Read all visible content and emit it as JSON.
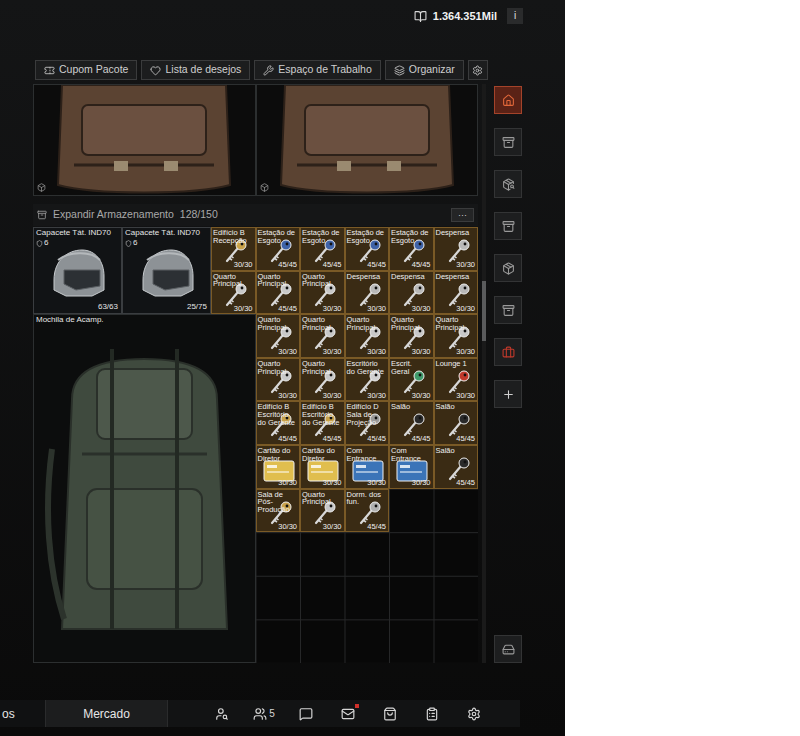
{
  "currency": {
    "amount": "1.364.351Mil",
    "info": "i"
  },
  "toolbar": [
    "Cupom Pacote",
    "Lista de desejos",
    "Espaço de Trabalho",
    "Organizar"
  ],
  "top_items": [
    {
      "kind": "backpack"
    },
    {
      "kind": "backpack"
    }
  ],
  "storage": {
    "title": "Expandir Armazenamento",
    "capacity": "128/150",
    "menu": "···"
  },
  "items": [
    {
      "kind": "helmet",
      "label": "Capacete Tát. IND70",
      "armor": "6",
      "count": "63/63"
    },
    {
      "kind": "helmet",
      "label": "Capacete Tát. IND70",
      "armor": "6",
      "count": "25/75"
    },
    {
      "kind": "key",
      "label": "Edifício B Recepção",
      "count": "30/30",
      "color": "#c9a24a"
    },
    {
      "kind": "key",
      "label": "Estação de Esgoto",
      "count": "45/45",
      "color": "#3f63a8"
    },
    {
      "kind": "key",
      "label": "Estação de Esgoto",
      "count": "45/45",
      "color": "#3f63a8"
    },
    {
      "kind": "key",
      "label": "Estação de Esgoto",
      "count": "45/45",
      "color": "#3f63a8"
    },
    {
      "kind": "key",
      "label": "Estação de Esgoto",
      "count": "45/45",
      "color": "#3f63a8"
    },
    {
      "kind": "key",
      "label": "Despensa",
      "count": "30/30",
      "color": "#b8b8b8"
    },
    {
      "kind": "key",
      "label": "Quarto Principal",
      "count": "30/30",
      "color": "#c8c8c8"
    },
    {
      "kind": "key",
      "label": "Quarto Principal",
      "count": "45/45",
      "color": "#c8c8c8"
    },
    {
      "kind": "key",
      "label": "Quarto Principal",
      "count": "30/30",
      "color": "#c8c8c8"
    },
    {
      "kind": "key",
      "label": "Despensa",
      "count": "30/30",
      "color": "#b8b8b8"
    },
    {
      "kind": "key",
      "label": "Despensa",
      "count": "30/30",
      "color": "#b8b8b8"
    },
    {
      "kind": "key",
      "label": "Despensa",
      "count": "30/30",
      "color": "#b8b8b8"
    },
    {
      "kind": "backpack",
      "label": "Mochila de Acamp."
    },
    {
      "kind": "key",
      "label": "Quarto Principal",
      "count": "30/30",
      "color": "#c8c8c8"
    },
    {
      "kind": "key",
      "label": "Quarto Principal",
      "count": "30/30",
      "color": "#c8c8c8"
    },
    {
      "kind": "key",
      "label": "Quarto Principal",
      "count": "30/30",
      "color": "#c8c8c8"
    },
    {
      "kind": "key",
      "label": "Quarto Principal",
      "count": "30/30",
      "color": "#c8c8c8"
    },
    {
      "kind": "key",
      "label": "Quarto Principal",
      "count": "30/30",
      "color": "#c8c8c8"
    },
    {
      "kind": "key",
      "label": "Quarto Principal",
      "count": "30/30",
      "color": "#c8c8c8"
    },
    {
      "kind": "key",
      "label": "Quarto Principal",
      "count": "30/30",
      "color": "#c8c8c8"
    },
    {
      "kind": "key",
      "label": "Escritório do Gerente",
      "count": "30/30",
      "color": "#d0d0d0"
    },
    {
      "kind": "key",
      "label": "Escrit. Geral",
      "count": "30/30",
      "color": "#3f9a6a"
    },
    {
      "kind": "key",
      "label": "Lounge 1",
      "count": "30/30",
      "color": "#c0392b"
    },
    {
      "kind": "key",
      "label": "Edifício B Escritório do Gerente",
      "count": "45/45",
      "color": "#c9a24a"
    },
    {
      "kind": "key",
      "label": "Edifício B Escritório do Gerente",
      "count": "45/45",
      "color": "#c9a24a"
    },
    {
      "kind": "key",
      "label": "Edifício D Sala de Projeção",
      "count": "45/45",
      "color": "#9a9a9a"
    },
    {
      "kind": "key",
      "label": "Salão",
      "count": "45/45",
      "color": "#2a2a2a"
    },
    {
      "kind": "key",
      "label": "Salão",
      "count": "45/45",
      "color": "#2a2a2a"
    },
    {
      "kind": "card",
      "label": "Cartão do Diretor",
      "count": "30/30",
      "color": "#e0be4e"
    },
    {
      "kind": "card",
      "label": "Cartão do Diretor",
      "count": "30/30",
      "color": "#e0be4e"
    },
    {
      "kind": "card",
      "label": "Com Entrance",
      "count": "30/30",
      "color": "#3b74b8"
    },
    {
      "kind": "card",
      "label": "Com Entrance",
      "count": "30/30",
      "color": "#3b74b8"
    },
    {
      "kind": "key",
      "label": "Salão",
      "count": "45/45",
      "color": "#2a2a2a"
    },
    {
      "kind": "key",
      "label": "Sala de Pós-Produção",
      "count": "30/30",
      "color": "#c9a24a"
    },
    {
      "kind": "key",
      "label": "Quarto Principal",
      "count": "30/30",
      "color": "#c8c8c8"
    },
    {
      "kind": "key",
      "label": "Dorm. dos fun.",
      "count": "45/45",
      "color": "#b0b0b0"
    }
  ],
  "scroll": {
    "level": 0.38
  },
  "sidebar": {
    "items": [
      {
        "selected": true,
        "color": "#e0673a"
      },
      {
        "selected": false,
        "color": "#9a9a9a"
      },
      {
        "selected": false,
        "color": "#9a9a9a"
      },
      {
        "selected": false,
        "color": "#9a9a9a"
      },
      {
        "selected": false,
        "color": "#9a9a9a"
      },
      {
        "selected": false,
        "color": "#9a9a9a"
      },
      {
        "selected": false,
        "color": "#c0392b"
      },
      {
        "selected": false,
        "color": "#d0d0d0"
      },
      {
        "selected": false,
        "color": "#9a9a9a"
      }
    ]
  },
  "bottom_bar": {
    "tabs": [
      {
        "label": "os",
        "selected": false
      },
      {
        "label": "Mercado",
        "selected": true
      }
    ],
    "icons": [
      {
        "badge": "",
        "dot": false
      },
      {
        "badge": "5",
        "dot": false
      },
      {
        "badge": "",
        "dot": false
      },
      {
        "badge": "",
        "dot": true
      },
      {
        "badge": "",
        "dot": false
      },
      {
        "badge": "",
        "dot": false
      },
      {
        "badge": "",
        "dot": false
      }
    ]
  }
}
